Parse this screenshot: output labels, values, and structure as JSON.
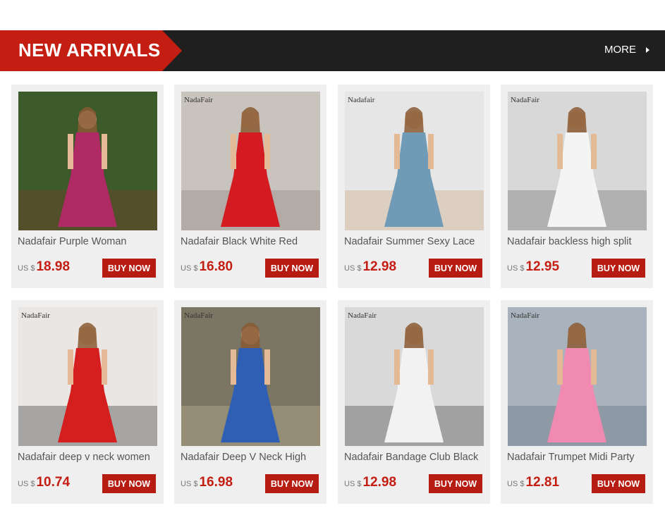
{
  "banner": {
    "title": "NEW ARRIVALS",
    "more_label": "MORE"
  },
  "currency": "US $",
  "buy_label": "BUY NOW",
  "products": [
    {
      "title": "Nadafair Purple Woman",
      "price": "18.98",
      "brand_mark": "",
      "palette": {
        "bg": "#3d5a2a",
        "figure": "#b02a66",
        "accent": "#7a3b2a"
      }
    },
    {
      "title": "Nadafair Black White Red",
      "price": "16.80",
      "brand_mark": "NadaFair",
      "palette": {
        "bg": "#c9c3bd",
        "figure": "#d41b22",
        "accent": "#8a7f78"
      }
    },
    {
      "title": "Nadafair Summer Sexy Lace",
      "price": "12.98",
      "brand_mark": "Nadafair",
      "palette": {
        "bg": "#e6e6e6",
        "figure": "#6f9bb7",
        "accent": "#c9a07a"
      }
    },
    {
      "title": "Nadafair backless high split",
      "price": "12.95",
      "brand_mark": "NadaFair",
      "palette": {
        "bg": "#d8d8d8",
        "figure": "#f4f4f4",
        "accent": "#6b6b6b"
      }
    },
    {
      "title": "Nadafair deep v neck women",
      "price": "10.74",
      "brand_mark": "NadaFair",
      "palette": {
        "bg": "#e9e6e3",
        "figure": "#d51f1f",
        "accent": "#2b2b2b"
      }
    },
    {
      "title": "Nadafair Deep V Neck High",
      "price": "16.98",
      "brand_mark": "NadaFair",
      "palette": {
        "bg": "#7b7563",
        "figure": "#2e5fb5",
        "accent": "#c9b99a"
      }
    },
    {
      "title": "Nadafair Bandage Club Black",
      "price": "12.98",
      "brand_mark": "NadaFair",
      "palette": {
        "bg": "#d9d9d9",
        "figure": "#f2f2f2",
        "accent": "#3a3a3a"
      }
    },
    {
      "title": "Nadafair Trumpet Midi Party",
      "price": "12.81",
      "brand_mark": "NadaFair",
      "palette": {
        "bg": "#a9b3bd",
        "figure": "#f08ab0",
        "accent": "#5b6b7a"
      }
    }
  ],
  "icons": {
    "more_arrow": "triangle-right-icon"
  }
}
